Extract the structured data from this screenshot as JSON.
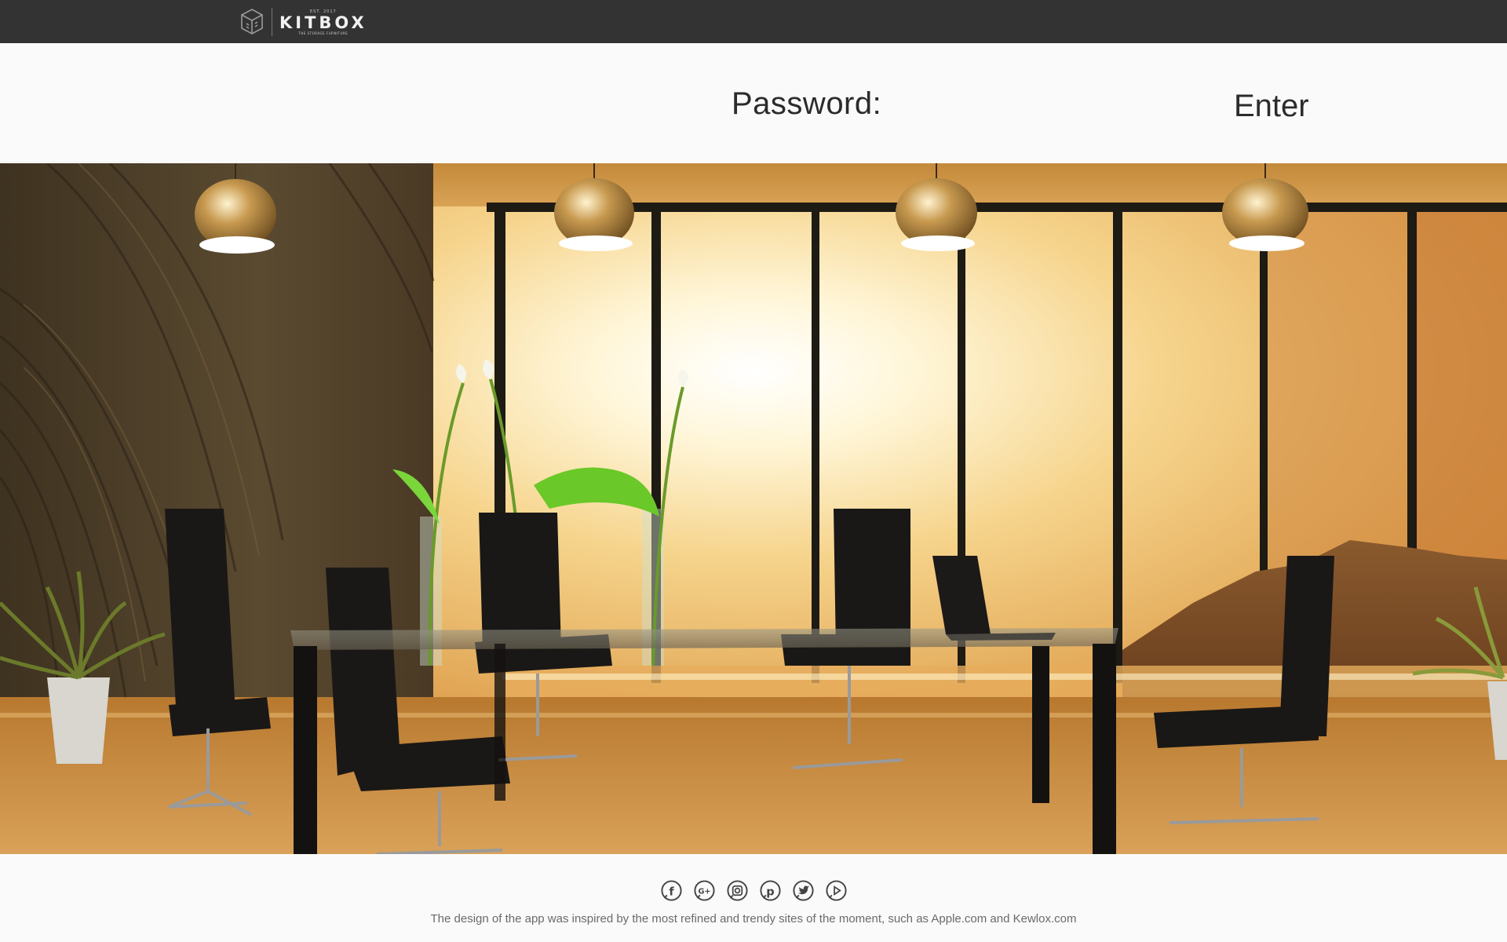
{
  "header": {
    "brand_est": "EST. 2017",
    "brand_name": "KITBOX",
    "brand_tagline": "THE STORAGE FURNITURE"
  },
  "login": {
    "password_label": "Password:",
    "password_placeholder": "",
    "enter_label": "Enter"
  },
  "hero": {
    "description": "Conference room with glass table, black leather chairs, gold pendant lamps and sunset view"
  },
  "footer": {
    "social_icons": [
      "facebook-icon",
      "google-plus-icon",
      "instagram-icon",
      "pinterest-icon",
      "twitter-icon",
      "youtube-icon"
    ],
    "credit_text": "The design of the app was inspired by the most refined and trendy sites of the moment, such as Apple.com and Kewlox.com"
  },
  "colors": {
    "topbar": "#333333",
    "page_bg": "#fafafa",
    "text_dark": "#2b2b2b",
    "footer_text": "#6a6a6a",
    "hero_warm": "#c88a3a"
  }
}
